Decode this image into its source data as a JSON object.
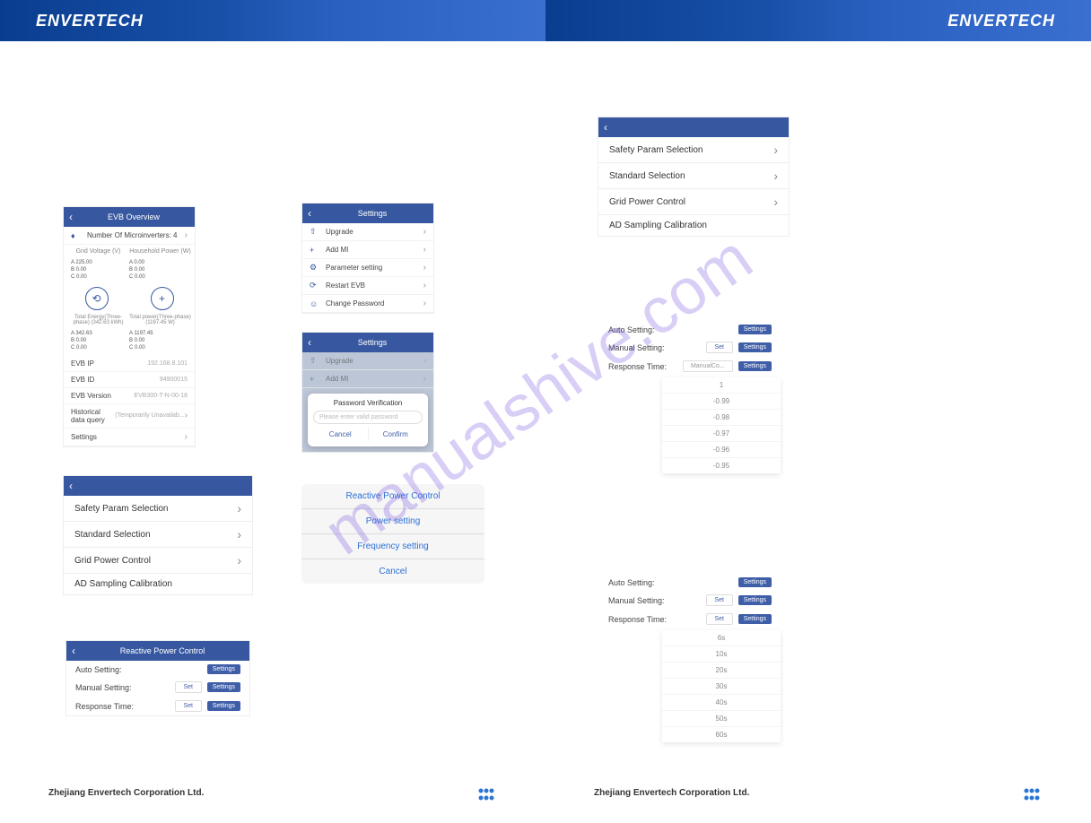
{
  "brand": "ENVERTECH",
  "footer": "Zhejiang Envertech Corporation Ltd.",
  "evb_overview": {
    "title": "EVB Overview",
    "micro_label": "Number Of Microinverters: 4",
    "grid_voltage_label": "Grid Voltage  (V)",
    "household_power_label": "Household Power  (W)",
    "gv": {
      "a": "A   225.00",
      "b": "B   0.00",
      "c": "C   0.00"
    },
    "hp": {
      "a": "A   0.00",
      "b": "B   0.00",
      "c": "C   0.00"
    },
    "total_energy_label": "Total Energy(Three-phase) (342.63 kWh)",
    "total_power_label": "Total power(Three-phase) (1197.45 W)",
    "te": {
      "a": "A   342.63",
      "b": "B   0.00",
      "c": "C   0.00"
    },
    "tp": {
      "a": "A   1197.45",
      "b": "B   0.00",
      "c": "C   0.00"
    },
    "rows": {
      "evb_ip": {
        "label": "EVB IP",
        "value": "192.168.8.101"
      },
      "evb_id": {
        "label": "EVB ID",
        "value": "94900015"
      },
      "evb_version": {
        "label": "EVB Version",
        "value": "EVB300-T-N-00-18"
      },
      "hist": {
        "label": "Historical data query",
        "value": "(Temporarily Unavailab..."
      },
      "settings": {
        "label": "Settings"
      }
    }
  },
  "settings": {
    "title": "Settings",
    "items": {
      "upgrade": "Upgrade",
      "addmi": "Add MI",
      "param": "Parameter setting",
      "restart": "Restart EVB",
      "change_pw": "Change Password"
    }
  },
  "pwmodal": {
    "title": "Password Verification",
    "placeholder": "Please enter valid password",
    "cancel": "Cancel",
    "confirm": "Confirm"
  },
  "safety_list": {
    "i0": "Safety Param Selection",
    "i1": "Standard Selection",
    "i2": "Grid Power Control",
    "i3": "AD Sampling Calibration"
  },
  "action_sheet": {
    "i0": "Reactive Power Control",
    "i1": "Power setting",
    "i2": "Frequency setting",
    "i3": "Cancel"
  },
  "rpc": {
    "title": "Reactive Power Control",
    "auto": "Auto Setting:",
    "manual": "Manual Setting:",
    "response": "Response Time:",
    "set": "Set",
    "settings_btn": "Settings",
    "manual_co": "ManualCo..."
  },
  "factor_opts": {
    "o0": "1",
    "o1": "-0.99",
    "o2": "-0.98",
    "o3": "-0.97",
    "o4": "-0.96",
    "o5": "-0.95"
  },
  "time_opts": {
    "o0": "6s",
    "o1": "10s",
    "o2": "20s",
    "o3": "30s",
    "o4": "40s",
    "o5": "50s",
    "o6": "60s"
  }
}
